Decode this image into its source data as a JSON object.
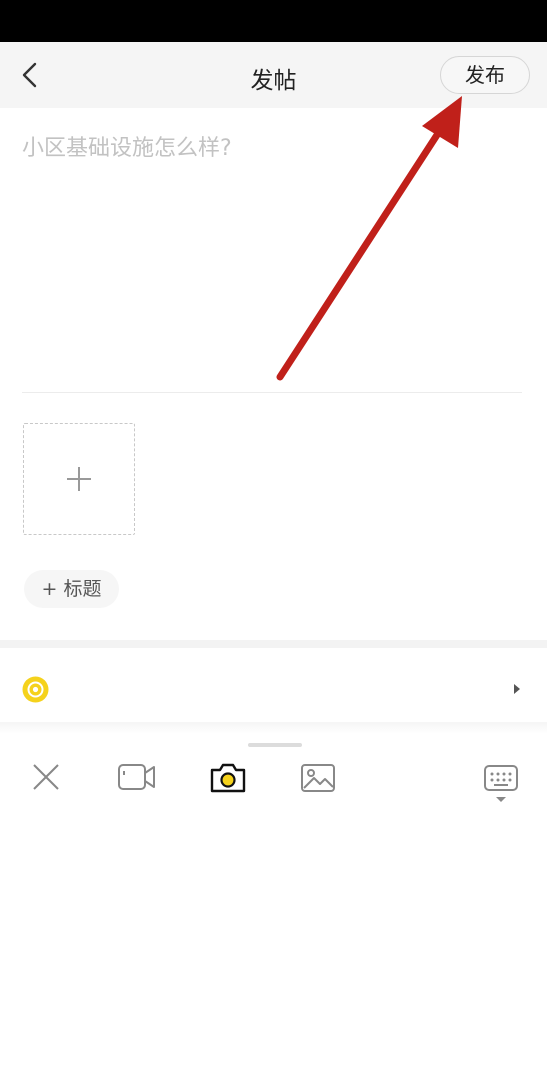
{
  "header": {
    "title": "发帖",
    "publish_label": "发布"
  },
  "editor": {
    "placeholder": "小区基础设施怎么样?",
    "value": ""
  },
  "media": {
    "add_title_label": "+ 标题"
  },
  "icons": {
    "back": "chevron-left-icon",
    "add_media": "plus-icon",
    "option": "yellow-circle-icon",
    "option_arrow": "triangle-right-icon",
    "toolbar": [
      "close-icon",
      "video-icon",
      "camera-icon",
      "image-icon",
      "keyboard-icon"
    ]
  },
  "colors": {
    "accent_yellow": "#f5d21c",
    "annotation_arrow": "#c0201a"
  }
}
